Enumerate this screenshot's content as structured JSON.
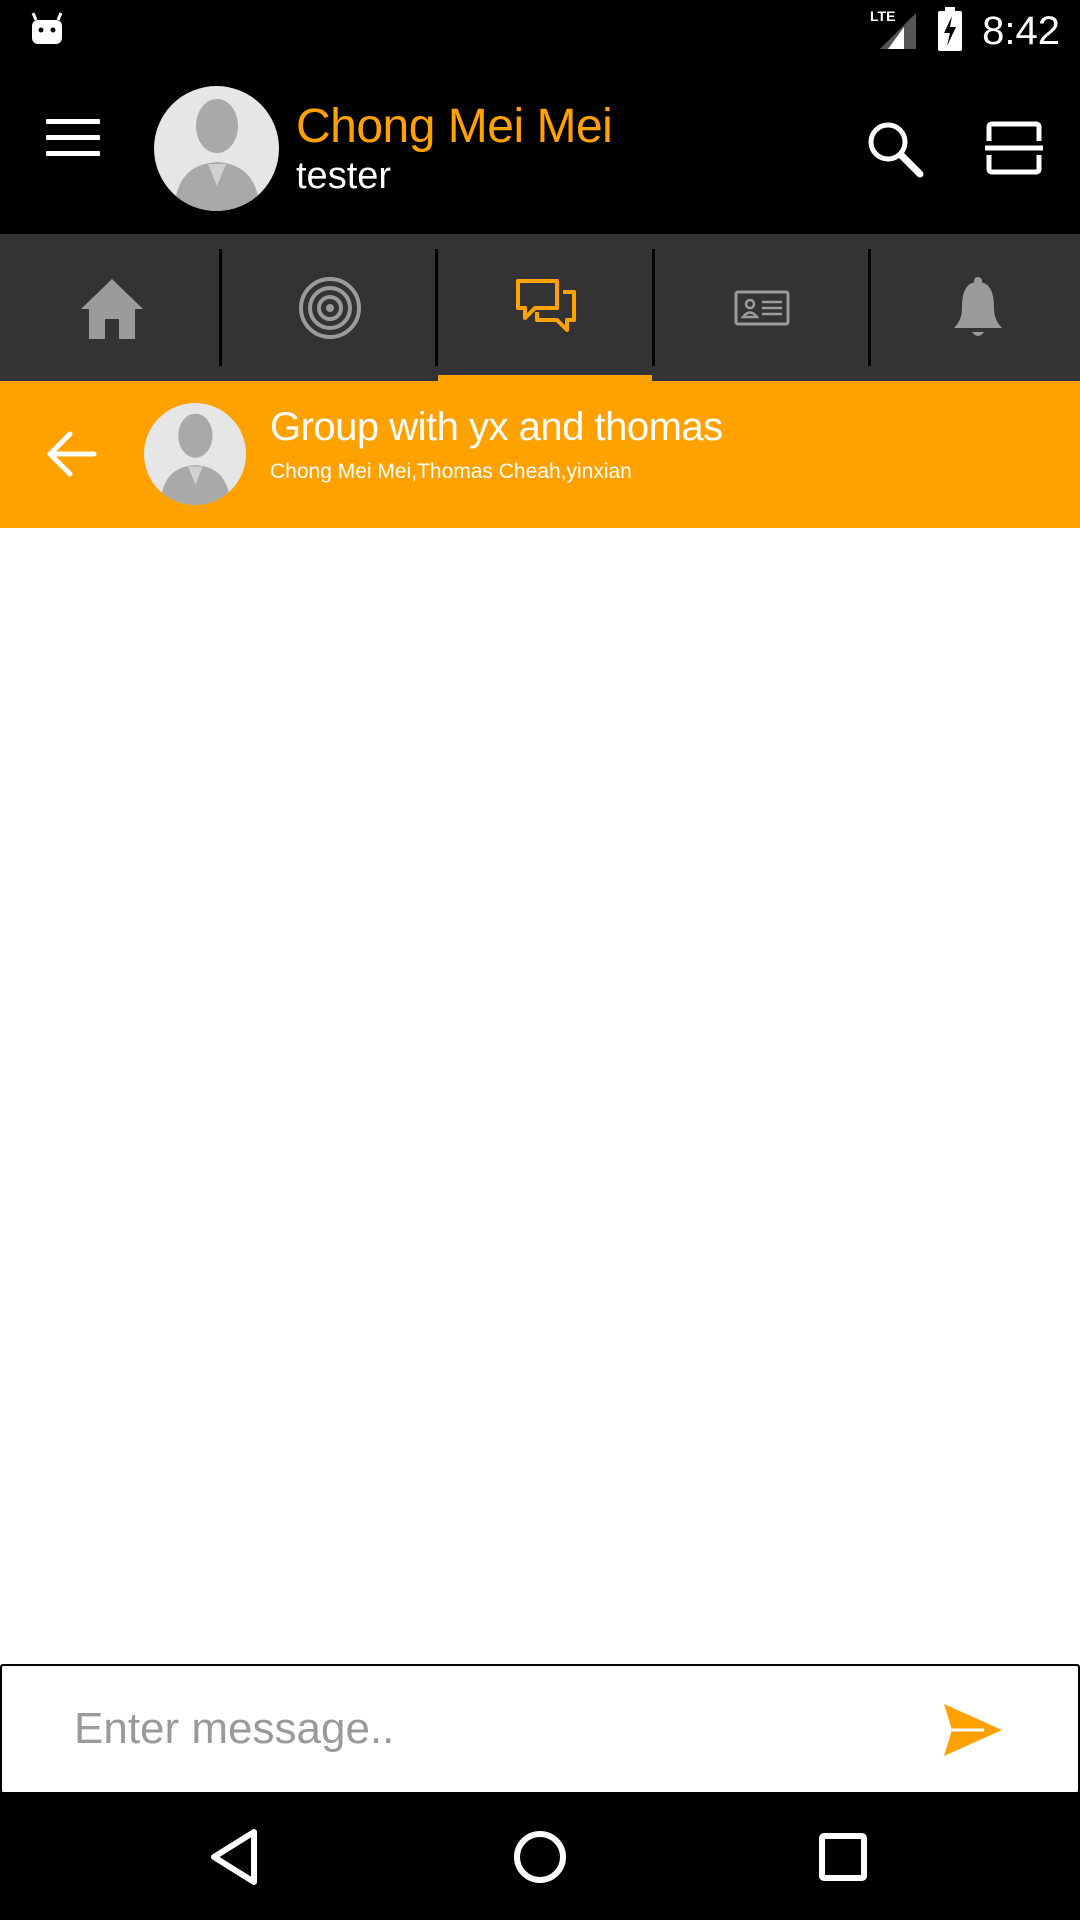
{
  "status_bar": {
    "network": "LTE",
    "time": "8:42"
  },
  "header": {
    "user_name": "Chong Mei Mei",
    "user_role": "tester",
    "icons": [
      "menu-icon",
      "avatar",
      "search-icon",
      "scan-icon"
    ]
  },
  "tabs": [
    {
      "icon": "home-icon",
      "selected": false
    },
    {
      "icon": "radar-icon",
      "selected": false
    },
    {
      "icon": "chat-icon",
      "selected": true
    },
    {
      "icon": "contact-card-icon",
      "selected": false
    },
    {
      "icon": "bell-icon",
      "selected": false
    }
  ],
  "chat": {
    "title": "Group with yx and thomas",
    "members": "Chong Mei Mei,Thomas Cheah,yinxian"
  },
  "composer": {
    "placeholder": "Enter message..",
    "value": ""
  },
  "colors": {
    "accent": "#ffa200",
    "header_bg": "#000000",
    "tabbar_bg": "#333335",
    "tab_icon_inactive": "#9b9b9b"
  }
}
